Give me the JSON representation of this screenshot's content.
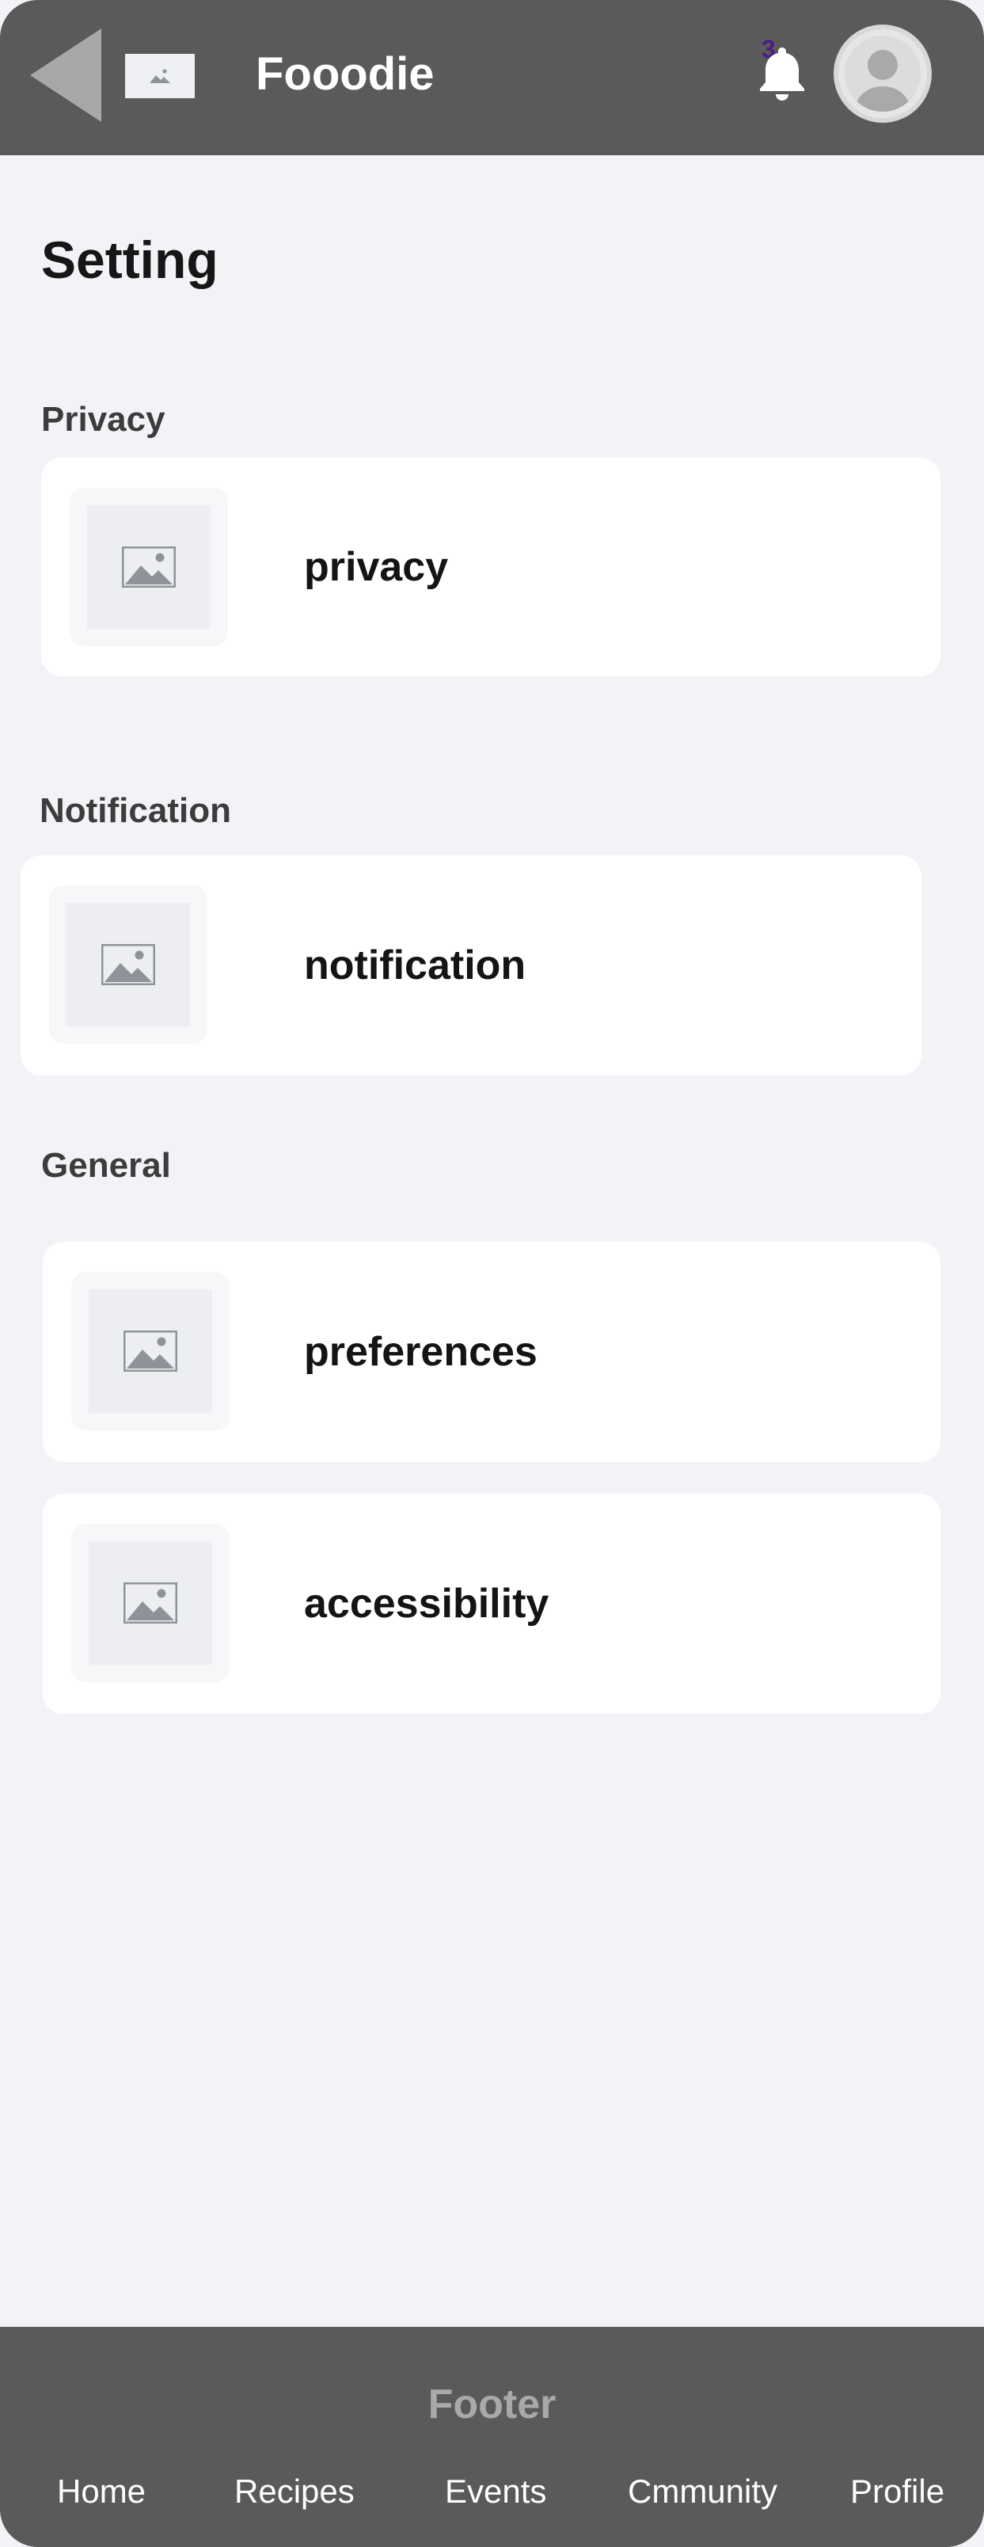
{
  "header": {
    "app_title": "Fooodie",
    "notification_count": "3",
    "icons": {
      "back": "back-arrow-icon",
      "logo": "image-placeholder-icon",
      "bell": "bell-icon",
      "avatar": "user-avatar-icon"
    }
  },
  "page": {
    "title": "Setting"
  },
  "sections": {
    "privacy": {
      "title": "Privacy",
      "items": [
        {
          "label": "privacy",
          "icon": "image-placeholder-icon"
        }
      ]
    },
    "notification": {
      "title": "Notification",
      "items": [
        {
          "label": "notification",
          "icon": "image-placeholder-icon"
        }
      ]
    },
    "general": {
      "title": "General",
      "items": [
        {
          "label": "preferences",
          "icon": "image-placeholder-icon"
        },
        {
          "label": "accessibility",
          "icon": "image-placeholder-icon"
        }
      ]
    }
  },
  "footer": {
    "title": "Footer",
    "links": [
      "Home",
      "Recipes",
      "Events",
      "Cmmunity",
      "Profile"
    ]
  },
  "colors": {
    "header_bg": "#5a5a5a",
    "page_bg": "#f3f3f7",
    "card_bg": "#ffffff",
    "badge_text": "#4b1d87"
  }
}
